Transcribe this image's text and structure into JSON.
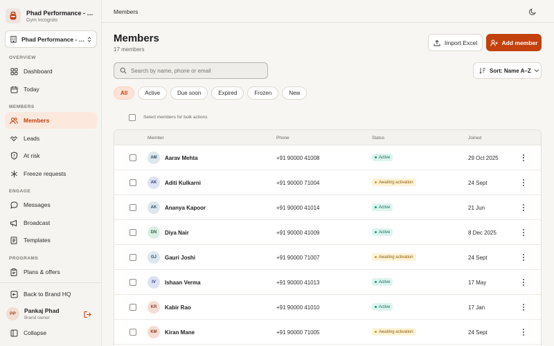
{
  "sidebar": {
    "brand_name": "Phad Performance - Kothrud",
    "brand_sub": "Gym Incognito",
    "gym_select": "Phad Performance - Kothrud",
    "sections": {
      "overview": "OVERVIEW",
      "members": "MEMBERS",
      "engage": "ENGAGE",
      "programs": "PROGRAMS"
    },
    "items": {
      "dashboard": "Dashboard",
      "today": "Today",
      "members": "Members",
      "leads": "Leads",
      "at_risk": "At risk",
      "freeze_requests": "Freeze requests",
      "messages": "Messages",
      "broadcast": "Broadcast",
      "templates": "Templates",
      "plans_offers": "Plans & offers"
    },
    "back_to_hq": "Back to Brand HQ",
    "user": {
      "initials": "PP",
      "name": "Pankaj Phad",
      "role": "Brand owner"
    },
    "collapse": "Collapse"
  },
  "topbar": {
    "title": "Members"
  },
  "page": {
    "title": "Members",
    "subtitle": "17 members"
  },
  "actions": {
    "import": "Import Excel",
    "add": "Add member"
  },
  "search": {
    "placeholder": "Search by name, phone or email",
    "value": ""
  },
  "sort": {
    "label": "Sort: Name A–Z"
  },
  "filters": [
    "All",
    "Active",
    "Due soon",
    "Expired",
    "Frozen",
    "New"
  ],
  "active_filter": "All",
  "bulk_label": "Select members for bulk actions",
  "table": {
    "headers": {
      "member": "Member",
      "phone": "Phone",
      "status": "Status",
      "joined": "Joined"
    },
    "rows": [
      {
        "initials": "AM",
        "name": "Aarav Mehta",
        "phone": "+91 90000 41008",
        "status": "Active",
        "joined": "29 Oct 2025",
        "avatar_bg": "#dde7ee",
        "avatar_fg": "#2f4b60"
      },
      {
        "initials": "AK",
        "name": "Aditi Kulkarni",
        "phone": "+91 90000 71004",
        "status": "Awaiting activation",
        "joined": "24 Sept",
        "avatar_bg": "#dee3f3",
        "avatar_fg": "#34407a"
      },
      {
        "initials": "AK",
        "name": "Ananya Kapoor",
        "phone": "+91 90000 41014",
        "status": "Active",
        "joined": "21 Jun",
        "avatar_bg": "#dde7ee",
        "avatar_fg": "#2f4b60"
      },
      {
        "initials": "DN",
        "name": "Diya Nair",
        "phone": "+91 90000 41009",
        "status": "Active",
        "joined": "8 Dec 2025",
        "avatar_bg": "#dcefe4",
        "avatar_fg": "#2d6347"
      },
      {
        "initials": "GJ",
        "name": "Gauri Joshi",
        "phone": "+91 90000 71007",
        "status": "Awaiting activation",
        "joined": "24 Sept",
        "avatar_bg": "#dde7ee",
        "avatar_fg": "#2f4b60"
      },
      {
        "initials": "IV",
        "name": "Ishaan Verma",
        "phone": "+91 90000 41013",
        "status": "Active",
        "joined": "17 May",
        "avatar_bg": "#dee3f3",
        "avatar_fg": "#34407a"
      },
      {
        "initials": "KR",
        "name": "Kabir Rao",
        "phone": "+91 90000 41010",
        "status": "Active",
        "joined": "17 Jan",
        "avatar_bg": "#f5ddd3",
        "avatar_fg": "#8a3f22"
      },
      {
        "initials": "KM",
        "name": "Kiran Mane",
        "phone": "+91 90000 71005",
        "status": "Awaiting activation",
        "joined": "24 Sept",
        "avatar_bg": "#f5ddd3",
        "avatar_fg": "#8a3f22"
      }
    ]
  },
  "colors": {
    "accent": "#c2410c",
    "active_nav_bg": "#fde8de",
    "status_active": "#0f9b7a",
    "status_await": "#d89710"
  }
}
